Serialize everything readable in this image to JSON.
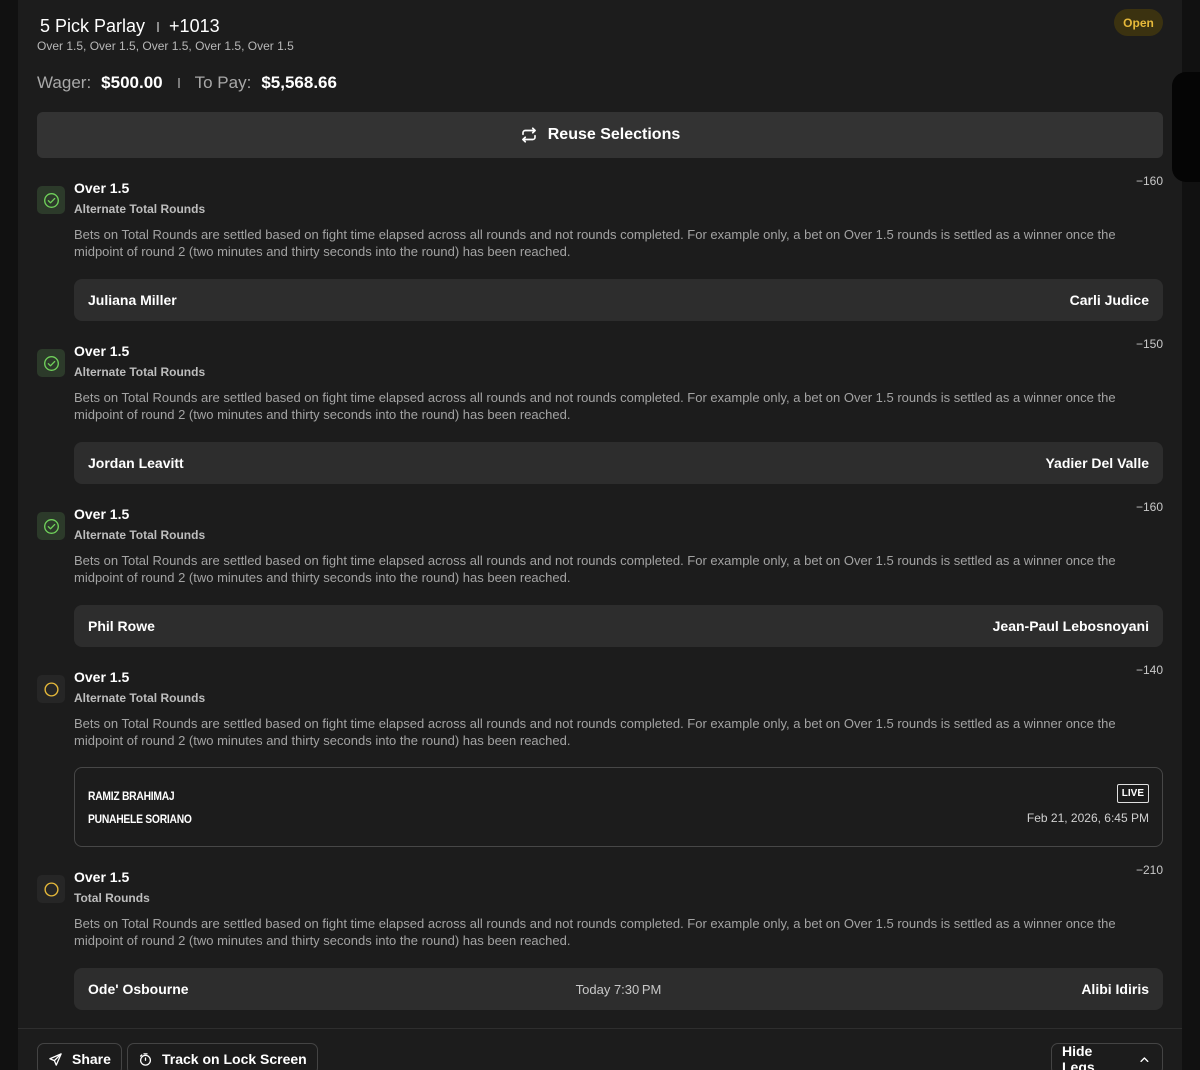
{
  "header": {
    "title": "5 Pick Parlay",
    "odds": "+1013",
    "subtitle": "Over 1.5, Over 1.5, Over 1.5, Over 1.5, Over 1.5",
    "status": "Open"
  },
  "wager": {
    "wager_label": "Wager:",
    "wager_value": "$500.00",
    "topay_label": "To Pay:",
    "topay_value": "$5,568.66"
  },
  "reuse_button": {
    "label": "Reuse Selections",
    "icon": "repeat-icon"
  },
  "legs": [
    {
      "status": "won",
      "pick": "Over 1.5",
      "market": "Alternate Total Rounds",
      "odds": "−160",
      "description": "Bets on Total Rounds are settled based on fight time elapsed across all rounds and not rounds completed. For example only, a bet on Over 1.5 rounds is settled as a winner once the midpoint of round 2 (two minutes and thirty seconds into the round) has been reached.",
      "fighter_1": "Juliana Miller",
      "fighter_2": "Carli Judice"
    },
    {
      "status": "won",
      "pick": "Over 1.5",
      "market": "Alternate Total Rounds",
      "odds": "−150",
      "description": "Bets on Total Rounds are settled based on fight time elapsed across all rounds and not rounds completed. For example only, a bet on Over 1.5 rounds is settled as a winner once the midpoint of round 2 (two minutes and thirty seconds into the round) has been reached.",
      "fighter_1": "Jordan Leavitt",
      "fighter_2": "Yadier Del Valle"
    },
    {
      "status": "won",
      "pick": "Over 1.5",
      "market": "Alternate Total Rounds",
      "odds": "−160",
      "description": "Bets on Total Rounds are settled based on fight time elapsed across all rounds and not rounds completed. For example only, a bet on Over 1.5 rounds is settled as a winner once the midpoint of round 2 (two minutes and thirty seconds into the round) has been reached.",
      "fighter_1": "Phil Rowe",
      "fighter_2": "Jean-Paul Lebosnoyani"
    },
    {
      "status": "open",
      "pick": "Over 1.5",
      "market": "Alternate Total Rounds",
      "odds": "−140",
      "description": "Bets on Total Rounds are settled based on fight time elapsed across all rounds and not rounds completed. For example only, a bet on Over 1.5 rounds is settled as a winner once the midpoint of round 2 (two minutes and thirty seconds into the round) has been reached.",
      "fighter_1": "RAMIZ BRAHIMAJ",
      "fighter_2": "PUNAHELE SORIANO",
      "live_badge": "LIVE",
      "datetime": "Feb 21, 2026, 6:45 PM"
    },
    {
      "status": "open",
      "pick": "Over 1.5",
      "market": "Total Rounds",
      "odds": "−210",
      "description": "Bets on Total Rounds are settled based on fight time elapsed across all rounds and not rounds completed. For example only, a bet on Over 1.5 rounds is settled as a winner once the midpoint of round 2 (two minutes and thirty seconds into the round) has been reached.",
      "fighter_1": "Ode' Osbourne",
      "fighter_2": "Alibi Idiris",
      "time": "Today 7:30 PM"
    }
  ],
  "footer": {
    "share_label": "Share",
    "track_label": "Track on Lock Screen",
    "hide_legs_label": "Hide Legs"
  },
  "colors": {
    "accent_yellow": "#e6b93a",
    "won_green": "#6fcf5a",
    "card_bg": "#1c1c1c",
    "button_bg": "#333333"
  }
}
